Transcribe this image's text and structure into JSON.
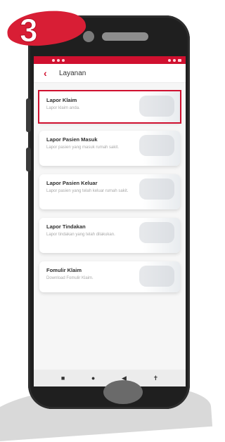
{
  "step_number": "3",
  "colors": {
    "accent": "#d0102f",
    "badge": "#d81e35"
  },
  "appbar": {
    "back_icon": "chevron-left-icon",
    "title": "Layanan"
  },
  "menu": [
    {
      "title": "Lapor Klaim",
      "subtitle": "Lapor klaim anda.",
      "highlighted": true
    },
    {
      "title": "Lapor Pasien Masuk",
      "subtitle": "Lapor pasien yang masuk rumah sakit.",
      "highlighted": false
    },
    {
      "title": "Lapor Pasien Keluar",
      "subtitle": "Lapor pasien yang telah keluar rumah sakit.",
      "highlighted": false
    },
    {
      "title": "Lapor Tindakan",
      "subtitle": "Lapor tindakan yang telah dilakukan.",
      "highlighted": false
    },
    {
      "title": "Fomulir Klaim",
      "subtitle": "Download Fomulir Klaim.",
      "highlighted": false
    }
  ],
  "navbar": {
    "icons": [
      "square-icon",
      "circle-icon",
      "back-triangle-icon",
      "accessibility-icon"
    ]
  }
}
